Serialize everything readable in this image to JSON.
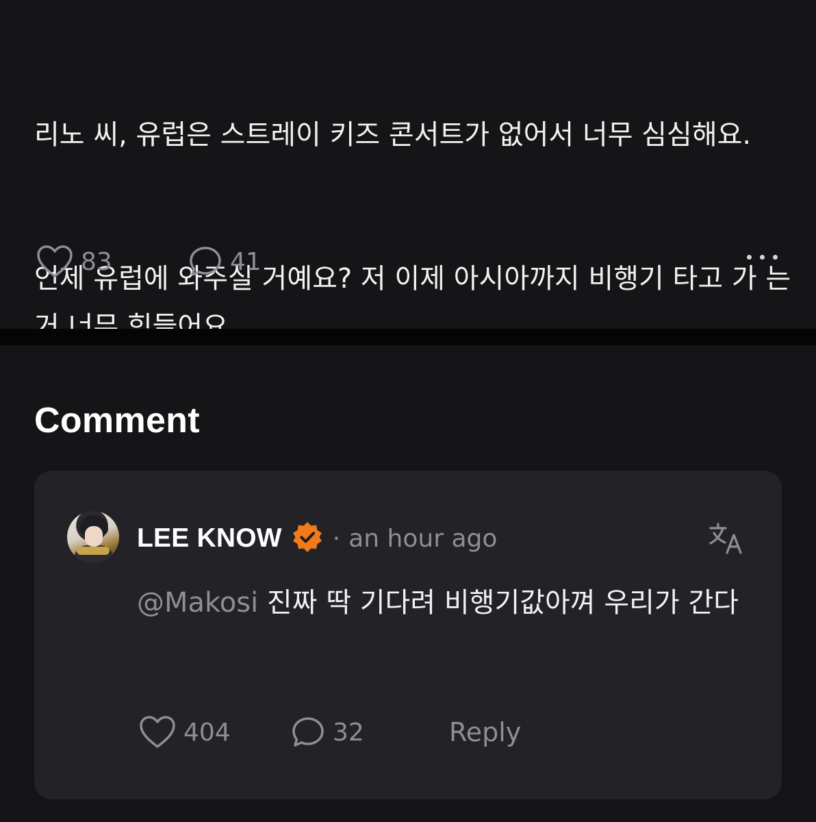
{
  "post": {
    "paragraphs": [
      "리노 씨, 유럽은 스트레이 키즈 콘서트가 없어서 너무 심심해요.",
      "언제 유럽에 와주실 거예요? 저 이제 아시아까지 비행기 타고 가 는 거 너무 힘들어요"
    ],
    "like_count": "83",
    "comment_count": "41",
    "icons": {
      "like": "heart-icon",
      "comment": "speech-bubble-icon",
      "more": "more-dots-icon"
    }
  },
  "comments_section": {
    "title": "Comment",
    "items": [
      {
        "author": "LEE KNOW",
        "verified": true,
        "separator": "·",
        "time": "an hour ago",
        "mention": "@Makosi",
        "text": " 진짜 딱 기다려 비행기값아껴 우리가 간다",
        "like_count": "404",
        "reply_count": "32",
        "reply_label": "Reply",
        "icons": {
          "badge": "verified-badge-icon",
          "translate": "translate-icon"
        }
      }
    ]
  },
  "colors": {
    "background": "#151518",
    "card": "#222227",
    "muted_text": "#8e8e95",
    "badge": "#f07a1c"
  }
}
